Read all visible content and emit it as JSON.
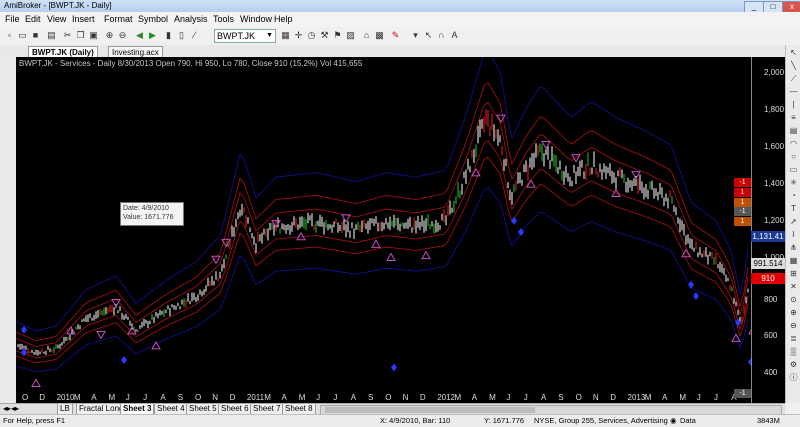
{
  "window": {
    "title": "AmiBroker - [BWPT.JK - Daily]",
    "min": "_",
    "max": "□",
    "close": "x"
  },
  "menu": [
    "File",
    "Edit",
    "View",
    "Insert",
    "Format",
    "Symbol",
    "Analysis",
    "Tools",
    "Window",
    "Help"
  ],
  "toolbar": {
    "symbol_value": "BWPT.JK"
  },
  "doc_tabs": [
    {
      "label": "BWPT.JK (Daily)",
      "active": true
    },
    {
      "label": "Investing.acx",
      "active": false
    }
  ],
  "chart": {
    "title": "BWPT.JK - Services - Daily 8/30/2013 Open 790, Hi 950, Lo 780, Close 910 (15.2%) Vol 415,655",
    "tooltip_date": "Date: 4/9/2010",
    "tooltip_value": "Value: 1671.776",
    "y_ticks": [
      "2,000",
      "1,800",
      "1,600",
      "1,400",
      "1,200",
      "1,000",
      "800",
      "600",
      "400"
    ],
    "price_labels": [
      {
        "text": "1,131.41",
        "color": "#1a3a9a"
      },
      {
        "text": "991.514",
        "color": "#cccccc"
      },
      {
        "text": "910",
        "color": "#e00000"
      }
    ],
    "right_badges": [
      "-1",
      "1",
      "1",
      "-1",
      "1",
      "-1"
    ],
    "x_ticks": [
      "O",
      "D",
      "2010",
      "M",
      "A",
      "M",
      "J",
      "J",
      "A",
      "S",
      "O",
      "N",
      "D",
      "2011",
      "M",
      "A",
      "M",
      "J",
      "J",
      "A",
      "S",
      "O",
      "N",
      "D",
      "2012",
      "M",
      "A",
      "M",
      "J",
      "J",
      "A",
      "S",
      "O",
      "N",
      "D",
      "2013",
      "M",
      "A",
      "M",
      "J",
      "J",
      "A"
    ]
  },
  "sheets": [
    {
      "label": "LB",
      "active": false
    },
    {
      "label": "Fractal Long",
      "active": false
    },
    {
      "label": "Sheet 3",
      "active": true
    },
    {
      "label": "Sheet 4",
      "active": false
    },
    {
      "label": "Sheet 5",
      "active": false
    },
    {
      "label": "Sheet 6",
      "active": false
    },
    {
      "label": "Sheet 7",
      "active": false
    },
    {
      "label": "Sheet 8",
      "active": false
    }
  ],
  "status": {
    "help": "For Help, press F1",
    "coords": "X: 4/9/2010, Bar: 110",
    "yval": "Y: 1671.776",
    "exchange": "NYSE, Group 255, Services, Advertising",
    "data": "Data",
    "memory": "3843M"
  },
  "colors": {
    "background": "#000000",
    "bull": "#22cc22",
    "bear": "#ee2222",
    "flat": "#ffffff",
    "env_red": "#b01010",
    "env_blue": "#1010a0",
    "triangle": "#c050c0",
    "diamond": "#2a3aff"
  }
}
